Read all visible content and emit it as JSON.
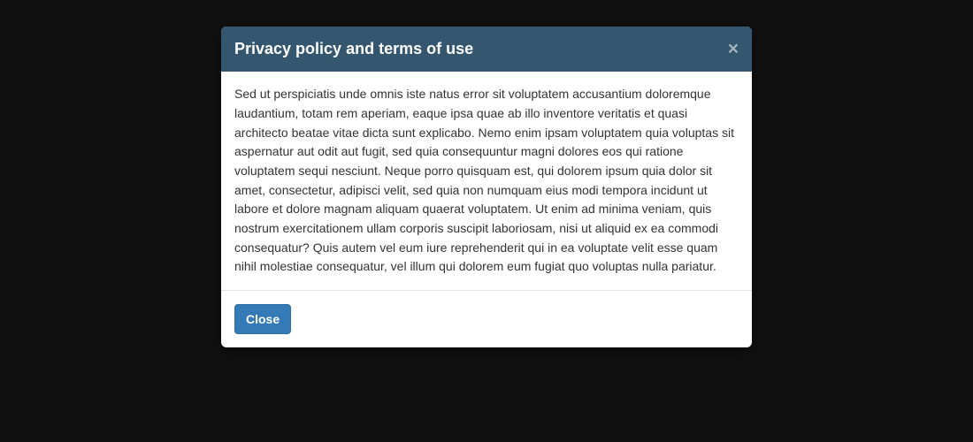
{
  "modal": {
    "title": "Privacy policy and terms of use",
    "body_text": "Sed ut perspiciatis unde omnis iste natus error sit voluptatem accusantium doloremque laudantium, totam rem aperiam, eaque ipsa quae ab illo inventore veritatis et quasi architecto beatae vitae dicta sunt explicabo. Nemo enim ipsam voluptatem quia voluptas sit aspernatur aut odit aut fugit, sed quia consequuntur magni dolores eos qui ratione voluptatem sequi nesciunt. Neque porro quisquam est, qui dolorem ipsum quia dolor sit amet, consectetur, adipisci velit, sed quia non numquam eius modi tempora incidunt ut labore et dolore magnam aliquam quaerat voluptatem. Ut enim ad minima veniam, quis nostrum exercitationem ullam corporis suscipit laboriosam, nisi ut aliquid ex ea commodi consequatur? Quis autem vel eum iure reprehenderit qui in ea voluptate velit esse quam nihil molestiae consequatur, vel illum qui dolorem eum fugiat quo voluptas nulla pariatur.",
    "close_button_label": "Close",
    "close_icon_glyph": "×"
  }
}
